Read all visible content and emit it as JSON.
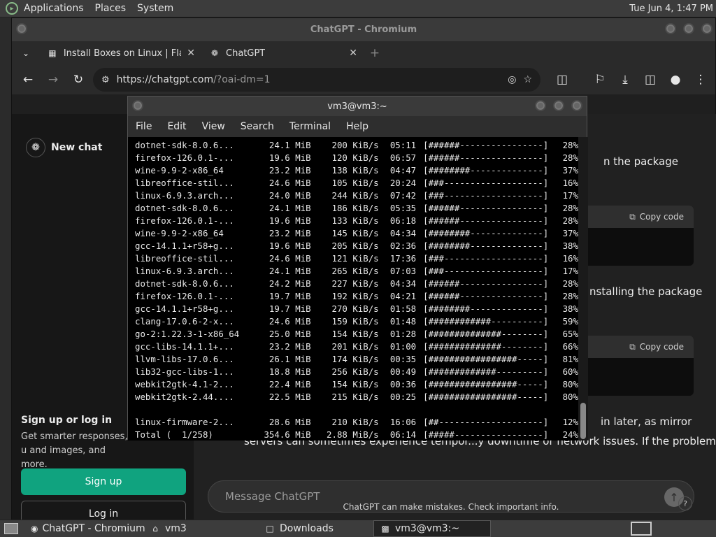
{
  "top_panel": {
    "menus": [
      "Applications",
      "Places",
      "System"
    ],
    "clock": "Tue Jun  4,  1:47 PM"
  },
  "chromium": {
    "window_title": "ChatGPT - Chromium",
    "tabs": [
      {
        "title": "Install Boxes on Linux | Flathub",
        "icon": "flathub-icon"
      },
      {
        "title": "ChatGPT",
        "icon": "chatgpt-icon"
      }
    ],
    "url": {
      "host": "https://chatgpt.com",
      "rest": "/?oai-dm=1"
    }
  },
  "chatgpt": {
    "new_chat": "New chat",
    "signup_title": "Sign up or log in",
    "signup_desc": "Get smarter responses, u and images, and more.",
    "signup_btn": "Sign up",
    "login_btn": "Log in",
    "text1": "n the package",
    "text2": "nstalling the package",
    "text3": "in later, as mirror",
    "text4": "servers can sometimes experience tempor...y downtime or network issues. If the problem",
    "copy_code": "Copy code",
    "message_placeholder": "Message ChatGPT",
    "disclaimer": "ChatGPT can make mistakes. Check important info.",
    "help": "?"
  },
  "terminal": {
    "title": "vm3@vm3:~",
    "menus": [
      "File",
      "Edit",
      "View",
      "Search",
      "Terminal",
      "Help"
    ],
    "rows": [
      [
        "dotnet-sdk-8.0.6...",
        "24.1 MiB",
        "200 KiB/s",
        "05:11",
        "[######----------------]",
        "28%"
      ],
      [
        "firefox-126.0.1-...",
        "19.6 MiB",
        "120 KiB/s",
        "06:57",
        "[######----------------]",
        "28%"
      ],
      [
        "wine-9.9-2-x86_64",
        "23.2 MiB",
        "138 KiB/s",
        "04:47",
        "[########--------------]",
        "37%"
      ],
      [
        "libreoffice-stil...",
        "24.6 MiB",
        "105 KiB/s",
        "20:24",
        "[###-------------------]",
        "16%"
      ],
      [
        "linux-6.9.3.arch...",
        "24.0 MiB",
        "244 KiB/s",
        "07:42",
        "[###-------------------]",
        "17%"
      ],
      [
        "dotnet-sdk-8.0.6...",
        "24.1 MiB",
        "186 KiB/s",
        "05:35",
        "[######----------------]",
        "28%"
      ],
      [
        "firefox-126.0.1-...",
        "19.6 MiB",
        "133 KiB/s",
        "06:18",
        "[######----------------]",
        "28%"
      ],
      [
        "wine-9.9-2-x86_64",
        "23.2 MiB",
        "145 KiB/s",
        "04:34",
        "[########--------------]",
        "37%"
      ],
      [
        "gcc-14.1.1+r58+g...",
        "19.6 MiB",
        "205 KiB/s",
        "02:36",
        "[########--------------]",
        "38%"
      ],
      [
        "libreoffice-stil...",
        "24.6 MiB",
        "121 KiB/s",
        "17:36",
        "[###-------------------]",
        "16%"
      ],
      [
        "linux-6.9.3.arch...",
        "24.1 MiB",
        "265 KiB/s",
        "07:03",
        "[###-------------------]",
        "17%"
      ],
      [
        "dotnet-sdk-8.0.6...",
        "24.2 MiB",
        "227 KiB/s",
        "04:34",
        "[######----------------]",
        "28%"
      ],
      [
        "firefox-126.0.1-...",
        "19.7 MiB",
        "192 KiB/s",
        "04:21",
        "[######----------------]",
        "28%"
      ],
      [
        "gcc-14.1.1+r58+g...",
        "19.7 MiB",
        "270 KiB/s",
        "01:58",
        "[########--------------]",
        "38%"
      ],
      [
        "clang-17.0.6-2-x...",
        "24.6 MiB",
        "159 KiB/s",
        "01:48",
        "[############----------]",
        "59%"
      ],
      [
        "go-2:1.22.3-1-x86_64",
        "25.0 MiB",
        "154 KiB/s",
        "01:28",
        "[##############--------]",
        "65%"
      ],
      [
        "gcc-libs-14.1.1+...",
        "23.2 MiB",
        "201 KiB/s",
        "01:00",
        "[##############--------]",
        "66%"
      ],
      [
        "llvm-libs-17.0.6...",
        "26.1 MiB",
        "174 KiB/s",
        "00:35",
        "[#################-----]",
        "81%"
      ],
      [
        "lib32-gcc-libs-1...",
        "18.8 MiB",
        "256 KiB/s",
        "00:49",
        "[#############---------]",
        "60%"
      ],
      [
        "webkit2gtk-4.1-2...",
        "22.4 MiB",
        "154 KiB/s",
        "00:36",
        "[#################-----]",
        "80%"
      ],
      [
        "webkit2gtk-2.44....",
        "22.5 MiB",
        "215 KiB/s",
        "00:25",
        "[#################-----]",
        "80%"
      ],
      [
        "",
        "",
        "",
        "",
        "",
        ""
      ],
      [
        "linux-firmware-2...",
        "28.6 MiB",
        "210 KiB/s",
        "16:06",
        "[##--------------------]",
        "12%"
      ],
      [
        "Total (  1/258)",
        "354.6 MiB",
        "2.88 MiB/s",
        "06:14",
        "[#####-----------------]",
        "24%"
      ]
    ]
  },
  "taskbar": {
    "items": [
      {
        "label": "ChatGPT - Chromium",
        "icon": "chromium-icon"
      },
      {
        "label": "vm3",
        "icon": "home-folder-icon"
      },
      {
        "label": "Downloads",
        "icon": "folder-icon"
      },
      {
        "label": "vm3@vm3:~",
        "icon": "terminal-icon"
      }
    ]
  },
  "colors": {
    "accent": "#10a37f"
  }
}
